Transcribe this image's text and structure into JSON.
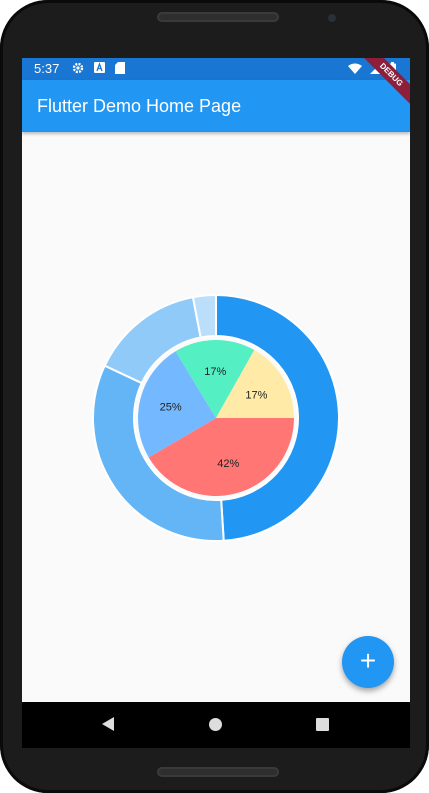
{
  "status_bar": {
    "time": "5:37"
  },
  "app_bar": {
    "title": "Flutter Demo Home Page"
  },
  "debug_banner": "DEBUG",
  "fab": {
    "icon": "add-icon",
    "label": "+"
  },
  "colors": {
    "status_bar": "#1976d2",
    "app_bar": "#2196f3",
    "outer_1": "#2196f3",
    "outer_2": "#64b5f6",
    "outer_3": "#90caf9",
    "outer_4": "#bbdefb",
    "inner_red": "#ff7675",
    "inner_blue": "#74b9ff",
    "inner_green": "#55efc4",
    "inner_yellow": "#ffeaa7"
  },
  "chart_data": [
    {
      "type": "pie",
      "name": "outer ring",
      "slices": [
        {
          "value": 49,
          "color": "#2196f3"
        },
        {
          "value": 33,
          "color": "#64b5f6"
        },
        {
          "value": 15,
          "color": "#90caf9"
        },
        {
          "value": 3,
          "color": "#bbdefb"
        }
      ]
    },
    {
      "type": "pie",
      "name": "inner pie",
      "slices": [
        {
          "value": 42,
          "label": "42%",
          "color": "#ff7675"
        },
        {
          "value": 25,
          "label": "25%",
          "color": "#74b9ff"
        },
        {
          "value": 17,
          "label": "17%",
          "color": "#55efc4"
        },
        {
          "value": 17,
          "label": "17%",
          "color": "#ffeaa7"
        }
      ]
    }
  ]
}
